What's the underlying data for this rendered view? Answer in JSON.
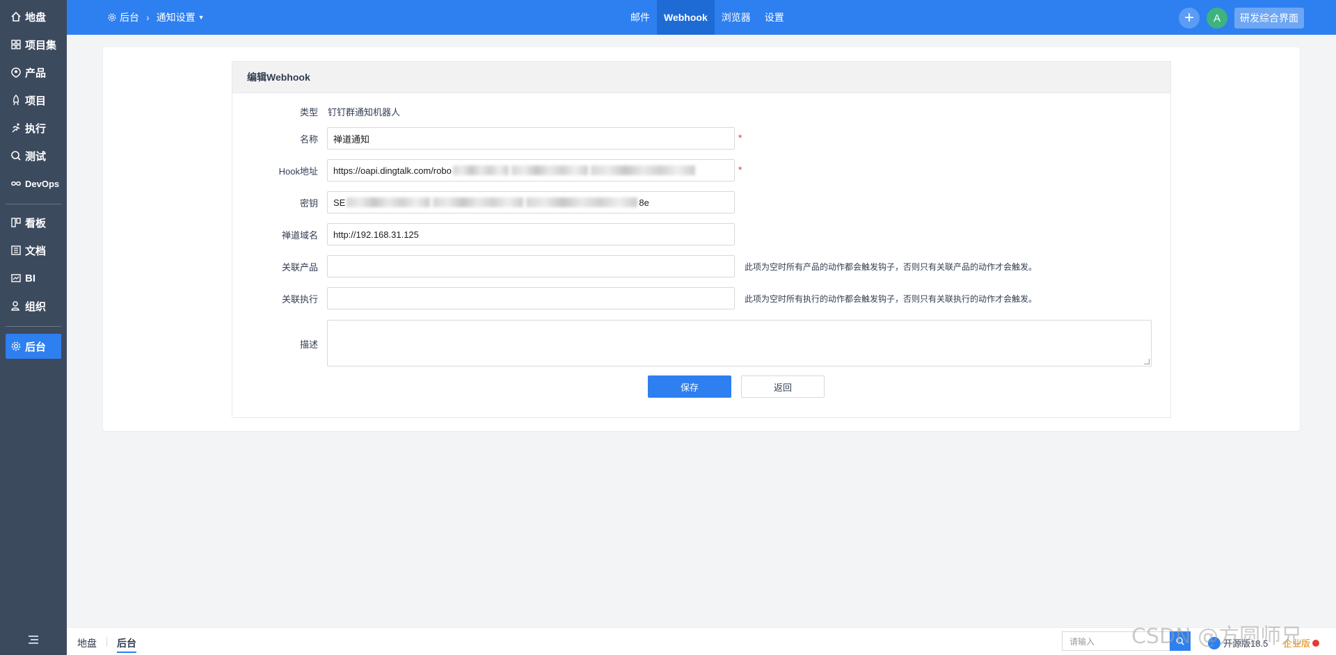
{
  "sidebar": {
    "items": [
      {
        "label": "地盘",
        "icon": "home-icon"
      },
      {
        "label": "项目集",
        "icon": "grid-icon"
      },
      {
        "label": "产品",
        "icon": "product-icon"
      },
      {
        "label": "项目",
        "icon": "project-icon"
      },
      {
        "label": "执行",
        "icon": "run-icon"
      },
      {
        "label": "测试",
        "icon": "test-icon"
      },
      {
        "label": "DevOps",
        "icon": "infinity-icon"
      },
      {
        "label": "看板",
        "icon": "kanban-icon"
      },
      {
        "label": "文档",
        "icon": "doc-icon"
      },
      {
        "label": "BI",
        "icon": "chart-icon"
      },
      {
        "label": "组织",
        "icon": "org-icon"
      },
      {
        "label": "后台",
        "icon": "gear-icon",
        "active": true
      }
    ]
  },
  "header": {
    "breadcrumb": {
      "root": "后台",
      "current": "通知设置"
    },
    "nav": [
      {
        "label": "邮件"
      },
      {
        "label": "Webhook",
        "active": true
      },
      {
        "label": "浏览器"
      },
      {
        "label": "设置"
      }
    ],
    "avatar_letter": "A",
    "switch_label": "研发综合界面"
  },
  "form": {
    "title": "编辑Webhook",
    "type_label": "类型",
    "type_value": "钉钉群通知机器人",
    "name_label": "名称",
    "name_value": "禅道通知",
    "hook_label": "Hook地址",
    "hook_value_prefix": "https://oapi.dingtalk.com/robo",
    "secret_label": "密钥",
    "secret_value_prefix": "SE",
    "secret_value_suffix": "8e",
    "domain_label": "禅道域名",
    "domain_value": "http://192.168.31.125",
    "product_label": "关联产品",
    "product_hint": "此项为空时所有产品的动作都会触发钩子，否则只有关联产品的动作才会触发。",
    "execution_label": "关联执行",
    "execution_hint": "此项为空时所有执行的动作都会触发钩子，否则只有关联执行的动作才会触发。",
    "desc_label": "描述",
    "required_mark": "*",
    "save_label": "保存",
    "back_label": "返回"
  },
  "footer": {
    "links": [
      {
        "label": "地盘"
      },
      {
        "label": "后台",
        "active": true
      }
    ],
    "search_placeholder": "请输入",
    "version": "开源版18.5",
    "enterprise": "企业版"
  },
  "watermark": "CSDN @方圆师兄"
}
